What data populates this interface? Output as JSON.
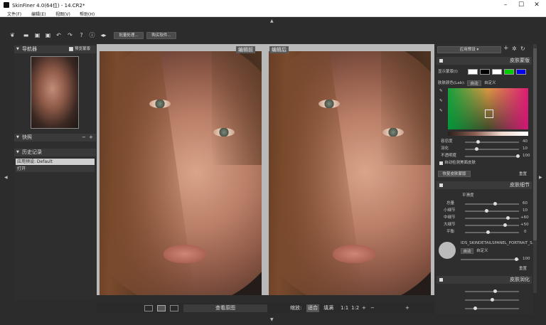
{
  "window": {
    "title": "SkinFiner 4.0(64位) - 14.CR2*"
  },
  "menu": {
    "items": [
      "文件(F)",
      "编辑(E)",
      "视图(V)",
      "帮助(H)"
    ]
  },
  "toolbar": {
    "batch_label": "批量处理...",
    "plugins_label": "购买软件..."
  },
  "navigator": {
    "title": "导航器",
    "checkbox_label": "预览蒙版"
  },
  "snapshots": {
    "title": "快照"
  },
  "history": {
    "title": "历史记录",
    "items": [
      "应用预设: Default",
      "打开"
    ]
  },
  "viewer": {
    "before_label": "编辑前",
    "after_label": "编辑后"
  },
  "bottombar": {
    "view_original": "查看原图",
    "zoom_label": "缩放:",
    "fit": "适合",
    "fill": "填满",
    "ratio1": "1:1",
    "ratio2": "1:2"
  },
  "right": {
    "preset_select": "应用预设",
    "skin_mask": {
      "title": "皮肤蒙版",
      "show_mask": "显示蒙版(I)",
      "skin_color": "肤肤颜色(Lab):",
      "auto": "自动",
      "custom": "自定义",
      "threshold": "容忍度",
      "feather": "羽化",
      "opacity": "不透明度",
      "auto_detect": "自动检测美面皮肤",
      "reset_btn": "恢复皮肤蒙版",
      "reset": "重置",
      "val1": "40",
      "val2": "10",
      "val3": "100"
    },
    "skin_detail": {
      "title": "皮肤细节",
      "smoothness": "平滑度",
      "overall": "总量",
      "small": "小细节",
      "medium": "中细节",
      "large": "大细节",
      "level": "平衡",
      "preset_name": "IDS_SKINDETAILSPANEL_PORTRAIT_S...",
      "auto": "自动",
      "custom": "自定义",
      "reset": "重置",
      "v_overall": "60",
      "v_small": "10",
      "v_medium": "+60",
      "v_large": "+50",
      "v_level": "0",
      "v_texture": "100"
    },
    "skin_glow": {
      "title": "皮肤润化"
    }
  },
  "colors": {
    "swatch1": "#000000",
    "swatch2": "#ffffff",
    "swatch3": "#00cc00",
    "swatch4": "#0000ee"
  }
}
